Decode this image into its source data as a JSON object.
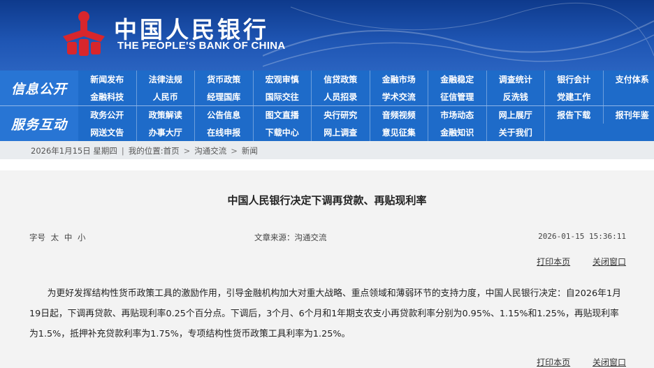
{
  "header": {
    "name_cn": "中国人民银行",
    "name_en": "THE PEOPLE'S BANK OF CHINA"
  },
  "nav": {
    "section1": {
      "label": "信息公开",
      "items": [
        "新闻发布",
        "法律法规",
        "货币政策",
        "宏观审慎",
        "信贷政策",
        "金融市场",
        "金融稳定",
        "调查统计",
        "银行会计",
        "支付体系",
        "金融科技",
        "人民币",
        "经理国库",
        "国际交往",
        "人员招录",
        "学术交流",
        "征信管理",
        "反洗钱",
        "党建工作"
      ]
    },
    "section2": {
      "label": "服务互动",
      "items": [
        "政务公开",
        "政策解读",
        "公告信息",
        "图文直播",
        "央行研究",
        "音频视频",
        "市场动态",
        "网上展厅",
        "报告下载",
        "报刊年鉴",
        "网送文告",
        "办事大厅",
        "在线申报",
        "下载中心",
        "网上调查",
        "意见征集",
        "金融知识",
        "关于我们"
      ]
    }
  },
  "breadcrumb": {
    "date": "2026年1月15日 星期四",
    "location_label": "我的位置:",
    "home": "首页",
    "level1": "沟通交流",
    "level2": "新闻"
  },
  "article": {
    "title": "中国人民银行决定下调再贷款、再贴现利率",
    "font_label": "字号",
    "font_options": [
      "太",
      "中",
      "小"
    ],
    "source": "文章来源：沟通交流",
    "datetime": "2026-01-15 15:36:11",
    "print_label": "打印本页",
    "close_label": "关闭窗口",
    "body": "为更好发挥结构性货币政策工具的激励作用，引导金融机构加大对重大战略、重点领域和薄弱环节的支持力度，中国人民银行决定：自2026年1月19日起，下调再贷款、再贴现利率0.25个百分点。下调后，3个月、6个月和1年期支农支小再贷款利率分别为0.95%、1.15%和1.25%，再贴现利率为1.5%，抵押补充贷款利率为1.75%，专项结构性货币政策工具利率为1.25%。"
  },
  "colors": {
    "header_blue": "#1f56b4",
    "nav_blue": "#1e6bc9",
    "emblem_red": "#d8262c"
  }
}
